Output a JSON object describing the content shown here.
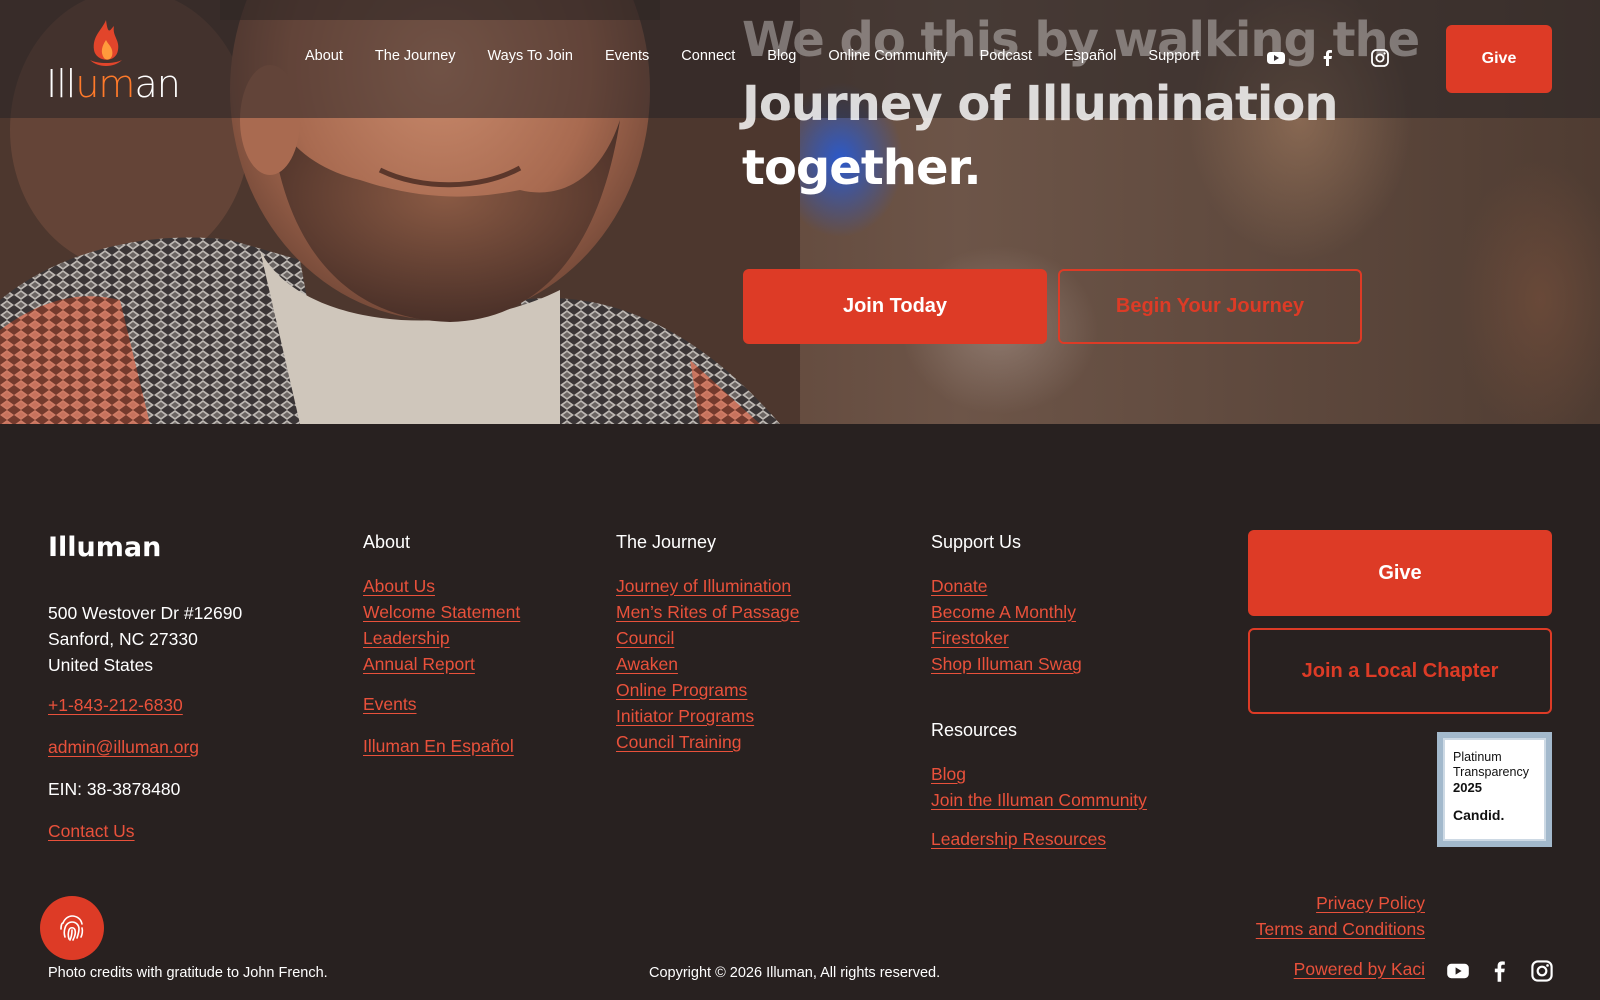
{
  "header": {
    "logo_text_pre": "Ill",
    "logo_text_accent": "um",
    "logo_text_post": "an",
    "nav": [
      "About",
      "The Journey",
      "Ways To Join",
      "Events",
      "Connect",
      "Blog",
      "Online Community",
      "Podcast",
      "Español",
      "Support"
    ],
    "social_icons": [
      "youtube-icon",
      "facebook-icon",
      "instagram-icon"
    ],
    "give_label": "Give"
  },
  "hero": {
    "headline_line1": "We do this by walking the",
    "headline_line2": "Journey of Illumination",
    "headline_line3": "together.",
    "join_label": "Join Today",
    "begin_label": "Begin Your Journey"
  },
  "footer": {
    "brand": "Illuman",
    "address": [
      "500 Westover Dr #12690",
      "Sanford, NC 27330",
      "United States"
    ],
    "phone": "+1-843-212-6830",
    "email": "admin@illuman.org",
    "ein": "EIN: 38-3878480",
    "contact": "Contact Us",
    "about": {
      "heading": "About",
      "links": [
        "About Us",
        "Welcome Statement",
        "Leadership",
        "Annual Report"
      ],
      "events": "Events",
      "espanol": "Illuman En Español"
    },
    "journey": {
      "heading": "The Journey",
      "links": [
        "Journey of Illumination",
        "Men’s Rites of Passage",
        "Council",
        "Awaken",
        "Online Programs",
        "Initiator Programs",
        "Council Training"
      ]
    },
    "support": {
      "heading": "Support Us",
      "links": [
        "Donate",
        "Become A Monthly",
        "Firestoker",
        "Shop Illuman Swag"
      ]
    },
    "resources": {
      "heading": "Resources",
      "links": [
        "Blog",
        "Join the Illuman Community"
      ],
      "leadership": "Leadership Resources"
    },
    "give_label": "Give",
    "chapter_label": "Join a Local Chapter",
    "seal": {
      "line1": "Platinum",
      "line2": "Transparency",
      "year": "2025",
      "brand": "Candid."
    },
    "privacy": "Privacy Policy",
    "terms": "Terms and Conditions",
    "powered": "Powered by Kaci",
    "credits": "Photo credits with gratitude to John French.",
    "copyright": "Copyright © 2026 Illuman, All rights reserved."
  },
  "colors": {
    "accent": "#dd3b26",
    "link": "#e9513b",
    "background": "#282120"
  }
}
